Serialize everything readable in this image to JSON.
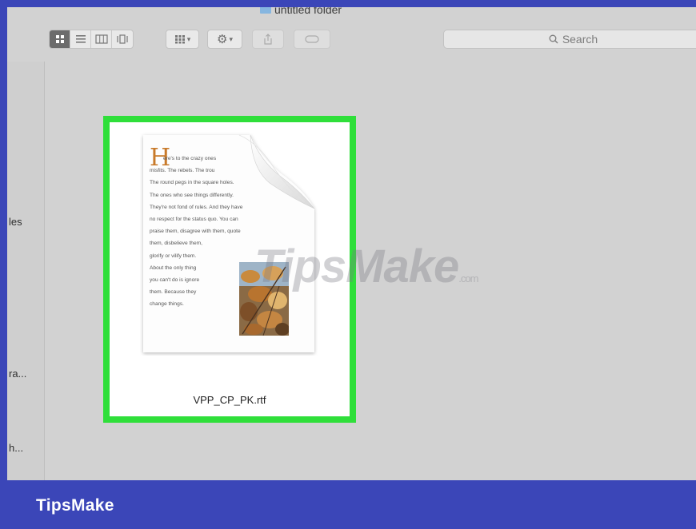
{
  "window": {
    "title": "untitled folder"
  },
  "toolbar": {
    "view_modes": [
      "icon-view",
      "list-view",
      "column-view",
      "cover-flow-view"
    ],
    "arrange_label": "arrange",
    "action_label": "action",
    "share_label": "share",
    "tags_label": "tags"
  },
  "search": {
    "placeholder": "Search"
  },
  "sidebar": {
    "items": [
      {
        "label": "les"
      },
      {
        "label": "ra..."
      },
      {
        "label": "h..."
      }
    ]
  },
  "file": {
    "name": "VPP_CP_PK.rtf",
    "preview": {
      "drop_cap": "H",
      "lines": [
        "ere's to the crazy ones",
        "misfits. The rebels. The trou",
        "The round pegs in the square holes.",
        "The ones who see things differently.",
        "They're not fond of rules. And they have",
        "no respect for the status quo. You can",
        "praise them, disagree with them, quote",
        "them, disbelieve them,",
        "glorify or vilify them.",
        "About the only thing",
        "you can't do is ignore",
        "them. Because they",
        "change things."
      ]
    }
  },
  "watermark": {
    "text": "TipsMake",
    "suffix": ".com"
  },
  "brand": {
    "text": "TipsMake"
  },
  "colors": {
    "accent_selection": "#2fdf3a",
    "brand_bar": "#3b46b8",
    "drop_cap": "#c87a2a"
  }
}
